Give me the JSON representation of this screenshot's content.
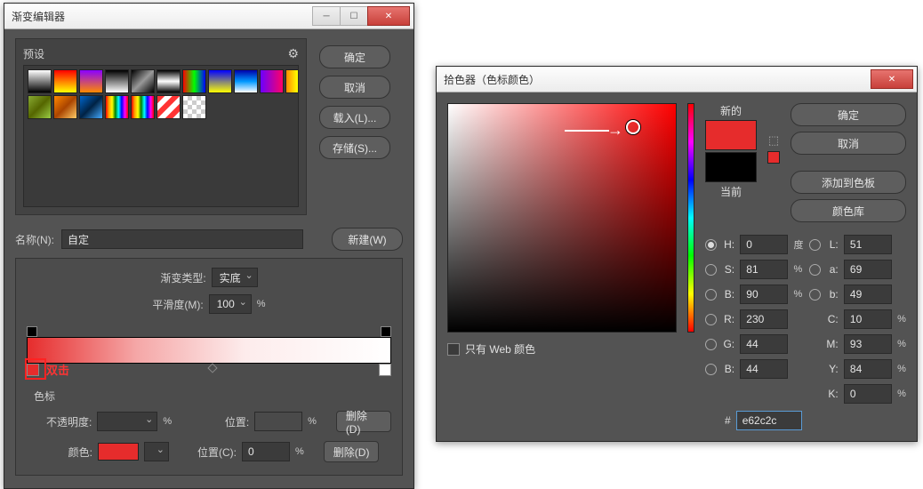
{
  "gradient_editor": {
    "title": "渐变编辑器",
    "preset_label": "预设",
    "gear_icon": "⚙",
    "buttons": {
      "ok": "确定",
      "cancel": "取消",
      "load": "载入(L)...",
      "save": "存储(S)..."
    },
    "name_label": "名称(N):",
    "name_value": "自定",
    "new_btn": "新建(W)",
    "grad_type_label": "渐变类型:",
    "grad_type_value": "实底",
    "smooth_label": "平滑度(M):",
    "smooth_value": "100",
    "percent": "%",
    "stops_label": "色标",
    "opacity_label": "不透明度:",
    "opacity_value": "",
    "pos_label": "位置:",
    "pos_value": "",
    "delete_btn": "删除(D)",
    "color_label": "颜色:",
    "posc_label": "位置(C):",
    "posc_value": "0",
    "annot": "双击",
    "presets": [
      "linear-gradient(to bottom,#fff,#000)",
      "linear-gradient(to bottom,#ff0000,#ffff00)",
      "linear-gradient(to bottom,#8a00ff,#ff8a00)",
      "linear-gradient(to bottom,#000,#fff)",
      "linear-gradient(135deg,#000,#999,#000)",
      "linear-gradient(to bottom,#000,#fff,#000)",
      "linear-gradient(to right,#f00,#0f0,#00f)",
      "linear-gradient(to bottom,#0000ff,#ffff00)",
      "linear-gradient(to bottom,#00a,#09f,#fff)",
      "linear-gradient(to right,#6a00ff,#ff0066)",
      "linear-gradient(to right,#ff8a00,#ffff00,#ff3300)",
      "linear-gradient(135deg,#8a3,#560,#9c4)",
      "linear-gradient(135deg,#f80,#a40,#fc6)",
      "linear-gradient(135deg,#06c,#024,#4af)",
      "linear-gradient(to right,red,orange,yellow,green,cyan,blue,magenta,red)",
      "linear-gradient(to right,red,orange,yellow,green,cyan,blue,magenta,red)",
      "repeating-linear-gradient(135deg,#f33 0 6px,#fff 6px 12px)",
      "repeating-conic-gradient(#ccc 0 25%,#fff 0 50%)"
    ]
  },
  "color_picker": {
    "title": "拾色器（色标颜色）",
    "ok": "确定",
    "cancel": "取消",
    "add_swatch": "添加到色板",
    "color_lib": "颜色库",
    "new_label": "新的",
    "cur_label": "当前",
    "new_color": "#e62c2c",
    "cur_color": "#000000",
    "deg": "度",
    "pct": "%",
    "H": "0",
    "S": "81",
    "B": "90",
    "R": "230",
    "G": "44",
    "Bv": "44",
    "L": "51",
    "a": "69",
    "b": "49",
    "C": "10",
    "M": "93",
    "Y": "84",
    "K": "0",
    "hex": "e62c2c",
    "hash": "#",
    "web_only": "只有 Web 颜色",
    "labels": {
      "H": "H:",
      "S": "S:",
      "B": "B:",
      "R": "R:",
      "G": "G:",
      "Bv": "B:",
      "L": "L:",
      "a": "a:",
      "b": "b:",
      "C": "C:",
      "M": "M:",
      "Y": "Y:",
      "K": "K:"
    }
  }
}
